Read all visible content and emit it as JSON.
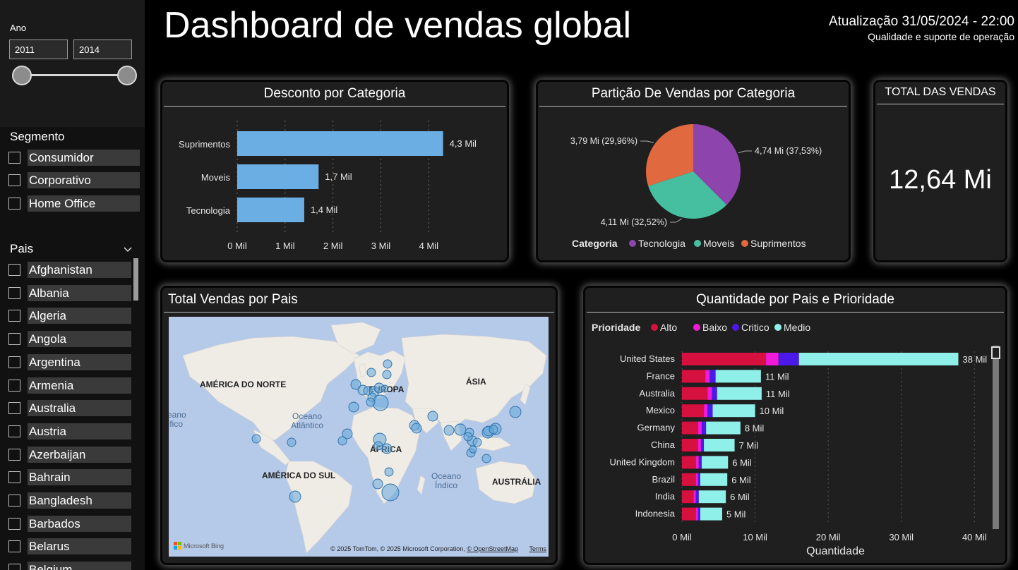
{
  "header": {
    "title": "Dashboard de vendas global",
    "update": "Atualização 31/05/2024 - 22:00",
    "subtitle": "Qualidade e suporte de operação"
  },
  "sidebar": {
    "year_label": "Ano",
    "year_from": "2011",
    "year_to": "2014",
    "segment_title": "Segmento",
    "segments": [
      "Consumidor",
      "Corporativo",
      "Home Office"
    ],
    "country_title": "Pais",
    "countries": [
      "Afghanistan",
      "Albania",
      "Algeria",
      "Angola",
      "Argentina",
      "Armenia",
      "Australia",
      "Austria",
      "Azerbaijan",
      "Bahrain",
      "Bangladesh",
      "Barbados",
      "Belarus",
      "Belgium"
    ]
  },
  "discount_card": {
    "title": "Desconto por Categoria",
    "chart_data": {
      "type": "bar",
      "orientation": "horizontal",
      "categories": [
        "Suprimentos",
        "Moveis",
        "Tecnologia"
      ],
      "values": [
        4.3,
        1.7,
        1.4
      ],
      "value_labels": [
        "4,3 Mil",
        "1,7 Mil",
        "1,4 Mil"
      ],
      "xticks": [
        "0 Mil",
        "1 Mil",
        "2 Mil",
        "3 Mil",
        "4 Mil"
      ],
      "xlim": [
        0,
        4.6
      ],
      "bar_color": "#6aaee3"
    }
  },
  "pie_card": {
    "title": "Partição De Vendas por Categoria",
    "chart_data": {
      "type": "pie",
      "slices": [
        {
          "name": "Tecnologia",
          "value": 4.74,
          "label": "4,74 Mi (37,53%)",
          "color": "#8e44ad"
        },
        {
          "name": "Moveis",
          "value": 4.11,
          "label": "4,11 Mi (32,52%)",
          "color": "#45bfa0"
        },
        {
          "name": "Suprimentos",
          "value": 3.79,
          "label": "3,79 Mi (29,96%)",
          "color": "#e0693f"
        }
      ],
      "legend_title": "Categoria",
      "legend_position": "bottom"
    }
  },
  "kpi_card": {
    "title": "TOTAL DAS VENDAS",
    "value": "12,64 Mi"
  },
  "map_card": {
    "title": "Total Vendas por Pais",
    "labels": {
      "na": "AMÉRICA DO NORTE",
      "eu": "EUROPA",
      "asia": "ÁSIA",
      "africa": "ÁFRICA",
      "sa": "AMÉRICA DO SUL",
      "au": "AUSTRÁLIA",
      "atl": "Oceano\nAtlântico",
      "ind": "Oceano\nÍndico",
      "pac": "eano\nífico"
    },
    "attribution": "© 2025 TomTom, © 2025 Microsoft Corporation,",
    "osm": "© OpenStreetMap",
    "terms": "Terms",
    "bing": "Microsoft Bing"
  },
  "priority_card": {
    "title": "Quantidade por Pais e Prioridade",
    "chart_data": {
      "type": "bar",
      "orientation": "horizontal",
      "stacked": true,
      "legend_title": "Prioridade",
      "categories": [
        "United States",
        "France",
        "Australia",
        "Mexico",
        "Germany",
        "China",
        "United Kingdom",
        "Brazil",
        "India",
        "Indonesia"
      ],
      "series": [
        {
          "name": "Alto",
          "color": "#d6103f",
          "values": [
            11.5,
            3.2,
            3.5,
            3.0,
            2.2,
            2.2,
            1.9,
            1.9,
            1.6,
            1.9
          ]
        },
        {
          "name": "Baixo",
          "color": "#f01bd8",
          "values": [
            1.7,
            0.6,
            0.6,
            0.5,
            0.5,
            0.4,
            0.4,
            0.3,
            0.3,
            0.3
          ]
        },
        {
          "name": "Critico",
          "color": "#4b1ae8",
          "values": [
            2.8,
            0.8,
            0.7,
            0.7,
            0.6,
            0.4,
            0.4,
            0.3,
            0.4,
            0.3
          ]
        },
        {
          "name": "Medio",
          "color": "#8ff0ea",
          "values": [
            21.8,
            6.2,
            6.1,
            5.8,
            4.7,
            4.2,
            3.6,
            3.7,
            3.7,
            3.0
          ]
        }
      ],
      "total_labels": [
        "38 Mil",
        "11 Mil",
        "11 Mil",
        "10 Mil",
        "8 Mil",
        "7 Mil",
        "6 Mil",
        "6 Mil",
        "6 Mil",
        "5 Mil"
      ],
      "xticks": [
        "0 Mil",
        "10 Mil",
        "20 Mil",
        "30 Mil",
        "40 Mil"
      ],
      "xlim": [
        0,
        42
      ],
      "xlabel": "Quantidade"
    }
  }
}
